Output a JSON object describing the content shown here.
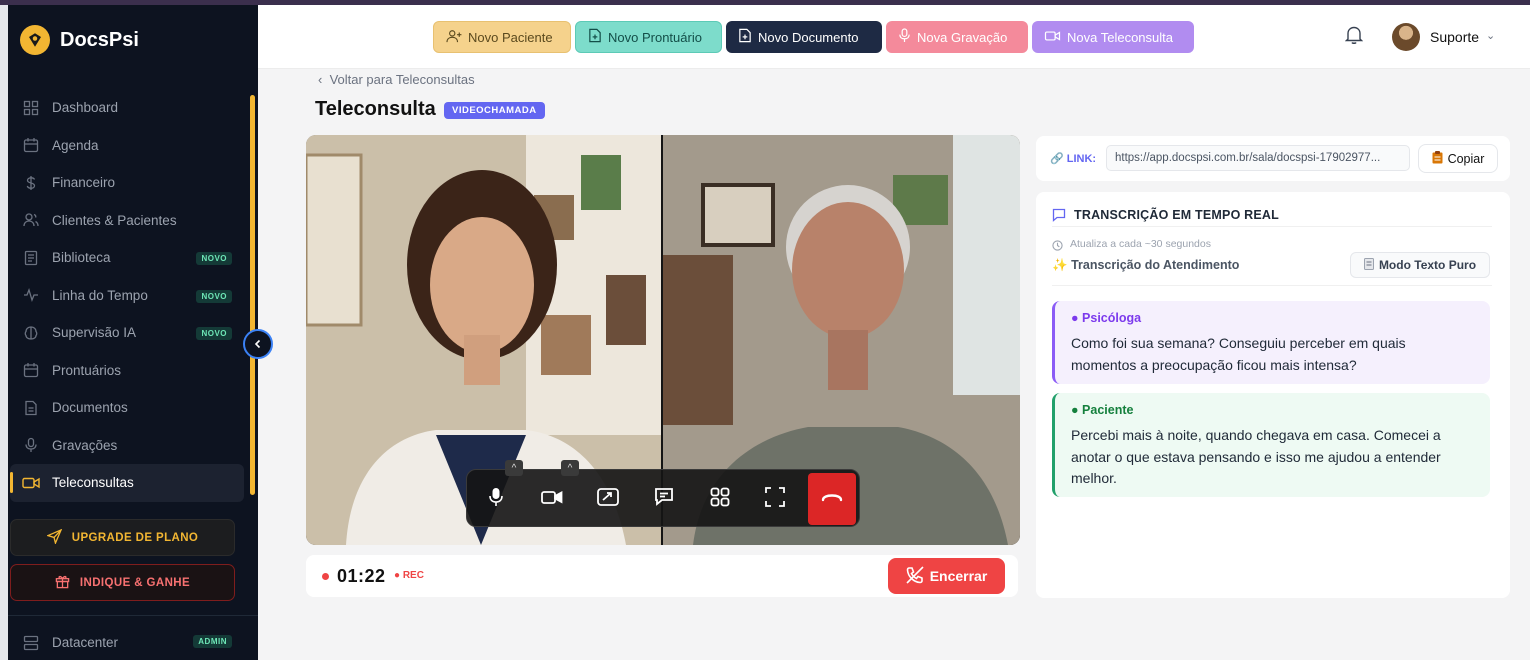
{
  "brand": {
    "name": "DocsPsi"
  },
  "sidebar": {
    "items": [
      {
        "label": "Dashboard",
        "icon": "grid-icon"
      },
      {
        "label": "Agenda",
        "icon": "calendar-icon"
      },
      {
        "label": "Financeiro",
        "icon": "dollar-icon"
      },
      {
        "label": "Clientes & Pacientes",
        "icon": "users-icon"
      },
      {
        "label": "Biblioteca",
        "icon": "book-icon",
        "badge": "NOVO"
      },
      {
        "label": "Linha do Tempo",
        "icon": "activity-icon",
        "badge": "NOVO"
      },
      {
        "label": "Supervisão IA",
        "icon": "brain-icon",
        "badge": "NOVO"
      },
      {
        "label": "Prontuários",
        "icon": "calendar-icon"
      },
      {
        "label": "Documentos",
        "icon": "file-icon"
      },
      {
        "label": "Gravações",
        "icon": "mic-icon"
      },
      {
        "label": "Teleconsultas",
        "icon": "video-icon",
        "active": true
      }
    ],
    "upgrade_label": "UPGRADE DE PLANO",
    "indique_label": "INDIQUE & GANHE",
    "datacenter_label": "Datacenter",
    "datacenter_badge": "ADMIN"
  },
  "header": {
    "actions": [
      "Novo Paciente",
      "Novo Prontuário",
      "Novo Documento",
      "Nova Gravação",
      "Nova Teleconsulta"
    ],
    "user_name": "Suporte"
  },
  "page": {
    "back_label": "Voltar para Teleconsultas",
    "title": "Teleconsulta",
    "badge": "VIDEOCHAMADA"
  },
  "call": {
    "timer": "01:22",
    "rec_label": "REC",
    "end_label": "Encerrar"
  },
  "link": {
    "label": "LINK:",
    "url": "https://app.docspsi.com.br/sala/docspsi-17902977...",
    "copy_label": "Copiar"
  },
  "transcript": {
    "title": "TRANSCRIÇÃO EM TEMPO REAL",
    "subtitle": "Atualiza a cada ~30 segundos",
    "heading": "Transcrição do Atendimento",
    "mode_label": "Modo Texto Puro",
    "messages": [
      {
        "speaker": "Psicóloga",
        "text": "Como foi sua semana? Conseguiu perceber em quais momentos a preocupação ficou mais intensa?"
      },
      {
        "speaker": "Paciente",
        "text": "Percebi mais à noite, quando chegava em casa. Comecei a anotar o que estava pensando e isso me ajudou a entender melhor."
      }
    ]
  },
  "colors": {
    "accent": "#f2b632",
    "sidebar_bg": "#0d1320",
    "badge": "#6366f1",
    "danger": "#ef4444"
  }
}
